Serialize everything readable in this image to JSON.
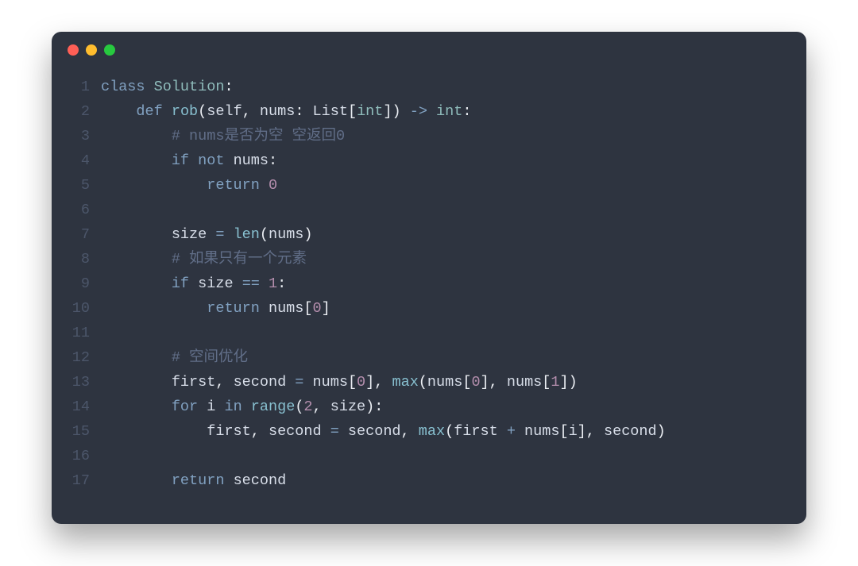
{
  "code": {
    "lines": [
      {
        "n": "1",
        "tokens": [
          [
            "kw",
            "class"
          ],
          [
            "sp",
            " "
          ],
          [
            "cls",
            "Solution"
          ],
          [
            "pun",
            ":"
          ]
        ]
      },
      {
        "n": "2",
        "tokens": [
          [
            "sp",
            "    "
          ],
          [
            "kw",
            "def"
          ],
          [
            "sp",
            " "
          ],
          [
            "fn",
            "rob"
          ],
          [
            "pun",
            "("
          ],
          [
            "id",
            "self"
          ],
          [
            "pun",
            ","
          ],
          [
            "sp",
            " "
          ],
          [
            "id",
            "nums"
          ],
          [
            "pun",
            ":"
          ],
          [
            "sp",
            " "
          ],
          [
            "id",
            "List"
          ],
          [
            "pun",
            "["
          ],
          [
            "cls",
            "int"
          ],
          [
            "pun",
            "]"
          ],
          [
            "pun",
            ")"
          ],
          [
            "sp",
            " "
          ],
          [
            "op",
            "->"
          ],
          [
            "sp",
            " "
          ],
          [
            "cls",
            "int"
          ],
          [
            "pun",
            ":"
          ]
        ]
      },
      {
        "n": "3",
        "tokens": [
          [
            "sp",
            "        "
          ],
          [
            "cmt",
            "# nums是否为空 空返回0"
          ]
        ]
      },
      {
        "n": "4",
        "tokens": [
          [
            "sp",
            "        "
          ],
          [
            "kw",
            "if"
          ],
          [
            "sp",
            " "
          ],
          [
            "kw",
            "not"
          ],
          [
            "sp",
            " "
          ],
          [
            "id",
            "nums"
          ],
          [
            "pun",
            ":"
          ]
        ]
      },
      {
        "n": "5",
        "tokens": [
          [
            "sp",
            "            "
          ],
          [
            "kw",
            "return"
          ],
          [
            "sp",
            " "
          ],
          [
            "num",
            "0"
          ]
        ]
      },
      {
        "n": "6",
        "tokens": []
      },
      {
        "n": "7",
        "tokens": [
          [
            "sp",
            "        "
          ],
          [
            "id",
            "size"
          ],
          [
            "sp",
            " "
          ],
          [
            "op",
            "="
          ],
          [
            "sp",
            " "
          ],
          [
            "fn",
            "len"
          ],
          [
            "pun",
            "("
          ],
          [
            "id",
            "nums"
          ],
          [
            "pun",
            ")"
          ]
        ]
      },
      {
        "n": "8",
        "tokens": [
          [
            "sp",
            "        "
          ],
          [
            "cmt",
            "# 如果只有一个元素"
          ]
        ]
      },
      {
        "n": "9",
        "tokens": [
          [
            "sp",
            "        "
          ],
          [
            "kw",
            "if"
          ],
          [
            "sp",
            " "
          ],
          [
            "id",
            "size"
          ],
          [
            "sp",
            " "
          ],
          [
            "op",
            "=="
          ],
          [
            "sp",
            " "
          ],
          [
            "num",
            "1"
          ],
          [
            "pun",
            ":"
          ]
        ]
      },
      {
        "n": "10",
        "tokens": [
          [
            "sp",
            "            "
          ],
          [
            "kw",
            "return"
          ],
          [
            "sp",
            " "
          ],
          [
            "id",
            "nums"
          ],
          [
            "pun",
            "["
          ],
          [
            "num",
            "0"
          ],
          [
            "pun",
            "]"
          ]
        ]
      },
      {
        "n": "11",
        "tokens": []
      },
      {
        "n": "12",
        "tokens": [
          [
            "sp",
            "        "
          ],
          [
            "cmt",
            "# 空间优化"
          ]
        ]
      },
      {
        "n": "13",
        "tokens": [
          [
            "sp",
            "        "
          ],
          [
            "id",
            "first"
          ],
          [
            "pun",
            ","
          ],
          [
            "sp",
            " "
          ],
          [
            "id",
            "second"
          ],
          [
            "sp",
            " "
          ],
          [
            "op",
            "="
          ],
          [
            "sp",
            " "
          ],
          [
            "id",
            "nums"
          ],
          [
            "pun",
            "["
          ],
          [
            "num",
            "0"
          ],
          [
            "pun",
            "]"
          ],
          [
            "pun",
            ","
          ],
          [
            "sp",
            " "
          ],
          [
            "fn",
            "max"
          ],
          [
            "pun",
            "("
          ],
          [
            "id",
            "nums"
          ],
          [
            "pun",
            "["
          ],
          [
            "num",
            "0"
          ],
          [
            "pun",
            "]"
          ],
          [
            "pun",
            ","
          ],
          [
            "sp",
            " "
          ],
          [
            "id",
            "nums"
          ],
          [
            "pun",
            "["
          ],
          [
            "num",
            "1"
          ],
          [
            "pun",
            "]"
          ],
          [
            "pun",
            ")"
          ]
        ]
      },
      {
        "n": "14",
        "tokens": [
          [
            "sp",
            "        "
          ],
          [
            "kw",
            "for"
          ],
          [
            "sp",
            " "
          ],
          [
            "id",
            "i"
          ],
          [
            "sp",
            " "
          ],
          [
            "kw",
            "in"
          ],
          [
            "sp",
            " "
          ],
          [
            "fn",
            "range"
          ],
          [
            "pun",
            "("
          ],
          [
            "num",
            "2"
          ],
          [
            "pun",
            ","
          ],
          [
            "sp",
            " "
          ],
          [
            "id",
            "size"
          ],
          [
            "pun",
            ")"
          ],
          [
            "pun",
            ":"
          ]
        ]
      },
      {
        "n": "15",
        "tokens": [
          [
            "sp",
            "            "
          ],
          [
            "id",
            "first"
          ],
          [
            "pun",
            ","
          ],
          [
            "sp",
            " "
          ],
          [
            "id",
            "second"
          ],
          [
            "sp",
            " "
          ],
          [
            "op",
            "="
          ],
          [
            "sp",
            " "
          ],
          [
            "id",
            "second"
          ],
          [
            "pun",
            ","
          ],
          [
            "sp",
            " "
          ],
          [
            "fn",
            "max"
          ],
          [
            "pun",
            "("
          ],
          [
            "id",
            "first"
          ],
          [
            "sp",
            " "
          ],
          [
            "op",
            "+"
          ],
          [
            "sp",
            " "
          ],
          [
            "id",
            "nums"
          ],
          [
            "pun",
            "["
          ],
          [
            "id",
            "i"
          ],
          [
            "pun",
            "]"
          ],
          [
            "pun",
            ","
          ],
          [
            "sp",
            " "
          ],
          [
            "id",
            "second"
          ],
          [
            "pun",
            ")"
          ]
        ]
      },
      {
        "n": "16",
        "tokens": []
      },
      {
        "n": "17",
        "tokens": [
          [
            "sp",
            "        "
          ],
          [
            "kw",
            "return"
          ],
          [
            "sp",
            " "
          ],
          [
            "id",
            "second"
          ]
        ]
      }
    ]
  }
}
